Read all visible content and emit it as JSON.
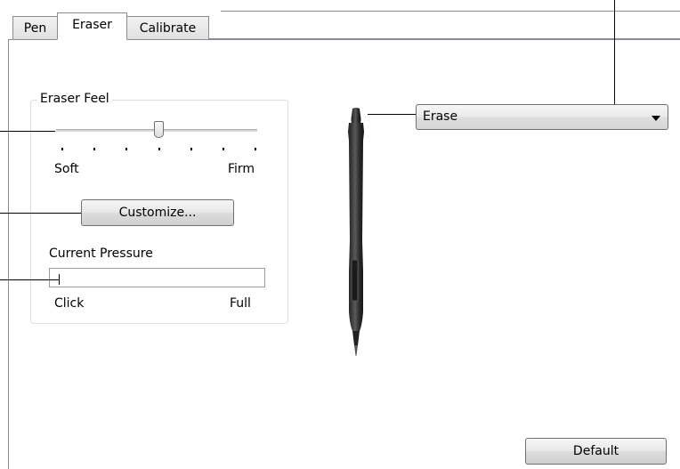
{
  "tabs": [
    {
      "label": "Pen",
      "active": false
    },
    {
      "label": "Eraser",
      "active": true
    },
    {
      "label": "Calibrate",
      "active": false
    }
  ],
  "eraser_feel": {
    "legend": "Eraser Feel",
    "min_label": "Soft",
    "max_label": "Firm",
    "tick_count": 7,
    "slider_position": 0.5
  },
  "customize_button": {
    "label": "Customize..."
  },
  "current_pressure": {
    "label": "Current Pressure",
    "min_label": "Click",
    "max_label": "Full",
    "value": 0
  },
  "eraser_function": {
    "selected": "Erase"
  },
  "default_button": {
    "label": "Default"
  },
  "icons": {
    "pen": "pen-tip-icon",
    "dropdown": "chevron-down-icon"
  }
}
